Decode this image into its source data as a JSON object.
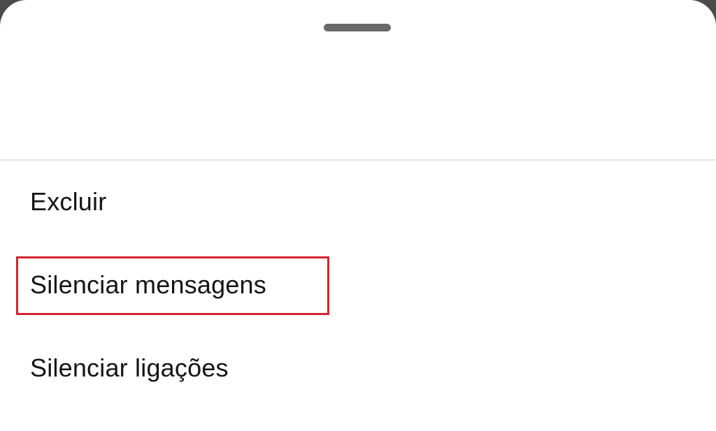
{
  "sheet": {
    "menu_items": [
      {
        "label": "Excluir"
      },
      {
        "label": "Silenciar mensagens",
        "highlighted": true
      },
      {
        "label": "Silenciar ligações"
      }
    ]
  },
  "colors": {
    "highlight_border": "#d32430",
    "text": "#151515",
    "sheet_background": "#ffffff",
    "handle": "#6a6a6a"
  }
}
